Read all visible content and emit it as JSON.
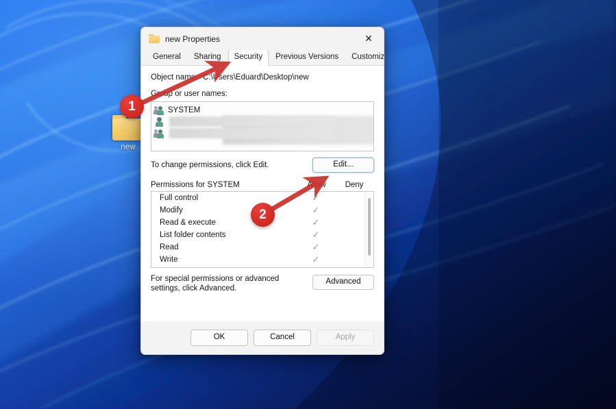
{
  "desktop": {
    "icon": {
      "name": "new",
      "type": "folder-icon"
    },
    "wallpaper": {
      "name": "windows-11-bloom-blue",
      "base_color": "#0b2a78"
    }
  },
  "dialog": {
    "title": "new Properties",
    "title_icon": "folder-icon",
    "close_label": "✕",
    "tabs": [
      {
        "label": "General",
        "active": false
      },
      {
        "label": "Sharing",
        "active": false
      },
      {
        "label": "Security",
        "active": true
      },
      {
        "label": "Previous Versions",
        "active": false
      },
      {
        "label": "Customize",
        "active": false
      }
    ],
    "object_name": {
      "label": "Object name:",
      "value": "C:\\Users\\Eduard\\Desktop\\new"
    },
    "group_section": {
      "label": "Group or user names:",
      "items": [
        {
          "name": "SYSTEM",
          "icon": "group-users-icon",
          "redacted": false
        },
        {
          "name": "",
          "icon": "single-user-icon",
          "redacted": true
        },
        {
          "name": "",
          "icon": "group-users-icon",
          "redacted": true
        }
      ],
      "hint": "To change permissions, click Edit.",
      "edit_label": "Edit..."
    },
    "permissions_section": {
      "header": "Permissions for SYSTEM",
      "col_allow": "Allow",
      "col_deny": "Deny",
      "check_glyph": "✓",
      "rows": [
        {
          "name": "Full control",
          "allow": true,
          "deny": false
        },
        {
          "name": "Modify",
          "allow": true,
          "deny": false
        },
        {
          "name": "Read & execute",
          "allow": true,
          "deny": false
        },
        {
          "name": "List folder contents",
          "allow": true,
          "deny": false
        },
        {
          "name": "Read",
          "allow": true,
          "deny": false
        },
        {
          "name": "Write",
          "allow": true,
          "deny": false
        }
      ]
    },
    "advanced_section": {
      "text_line1": "For special permissions or advanced settings,",
      "text_line2": "click Advanced.",
      "advanced_label": "Advanced"
    },
    "footer": {
      "ok_label": "OK",
      "cancel_label": "Cancel",
      "apply_label": "Apply",
      "apply_disabled": true
    }
  },
  "annotations": {
    "accent_color": "#d32b24",
    "badges": [
      {
        "number": "1",
        "points_to": "Security tab"
      },
      {
        "number": "2",
        "points_to": "Edit... button"
      }
    ]
  }
}
